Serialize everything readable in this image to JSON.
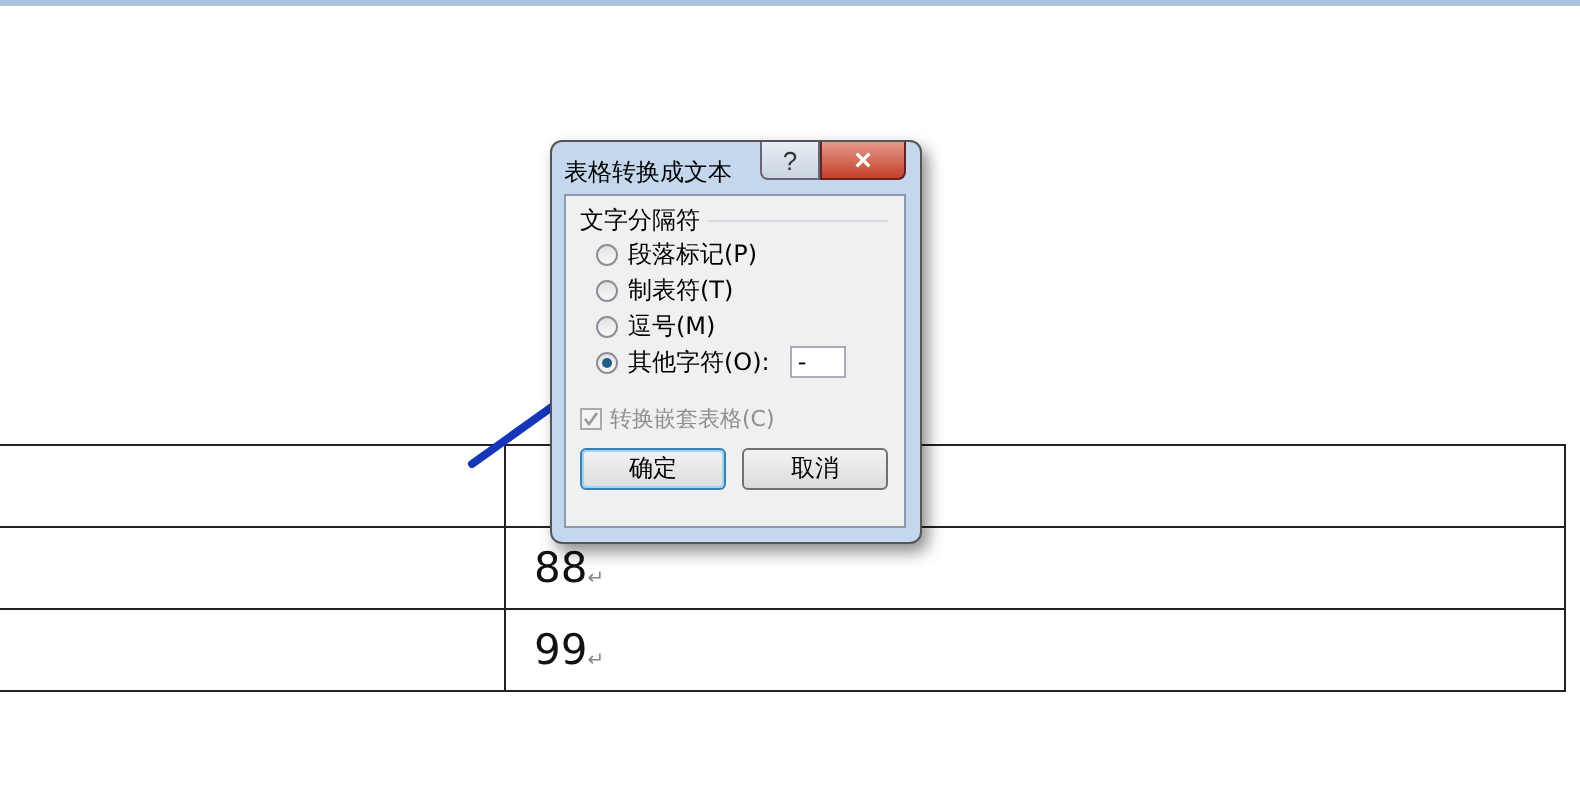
{
  "table": {
    "rows": [
      {
        "cells": [
          {
            "text": ""
          },
          {
            "text": ""
          }
        ]
      },
      {
        "cells": [
          {
            "text": ""
          },
          {
            "text": "88",
            "mark": "↵"
          }
        ]
      },
      {
        "cells": [
          {
            "text": ""
          },
          {
            "text": "99",
            "mark": "↵"
          }
        ]
      }
    ]
  },
  "dialog": {
    "title": "表格转换成文本",
    "help": "?",
    "close": "×",
    "group": {
      "title": "文字分隔符",
      "options": [
        {
          "label": "段落标记(P)",
          "selected": false
        },
        {
          "label": "制表符(T)",
          "selected": false
        },
        {
          "label": "逗号(M)",
          "selected": false
        },
        {
          "label": "其他字符(O):",
          "selected": true
        }
      ],
      "other_value": "-"
    },
    "nested": {
      "label": "转换嵌套表格(C)",
      "checked": true,
      "disabled": true
    },
    "buttons": [
      {
        "label": "确定",
        "default": true
      },
      {
        "label": "取消",
        "default": false
      }
    ]
  }
}
